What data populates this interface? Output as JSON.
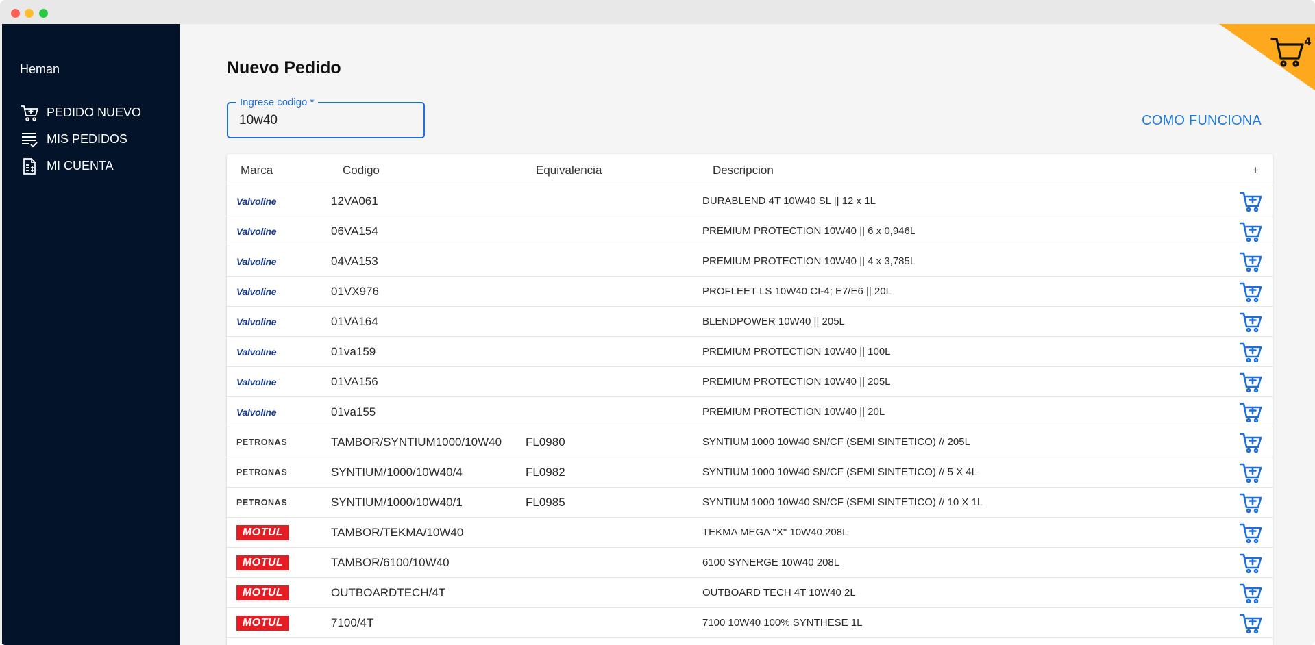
{
  "window": {
    "title": ""
  },
  "sidebar": {
    "user": "Heman",
    "items": [
      {
        "label": "PEDIDO NUEVO",
        "icon": "cart-plus-icon"
      },
      {
        "label": "MIS PEDIDOS",
        "icon": "list-check-icon"
      },
      {
        "label": "MI CUENTA",
        "icon": "document-account-icon"
      }
    ]
  },
  "header": {
    "title": "Nuevo Pedido",
    "search": {
      "label": "Ingrese codigo",
      "required_mark": "*",
      "value": "10w40"
    },
    "help_link": "COMO FUNCIONA",
    "cart_count": "4"
  },
  "colors": {
    "sidebar": "#03142a",
    "accent": "#1e6fd9",
    "cart_corner": "#fda81d",
    "motul": "#e31e24",
    "valvoline": "#1a3d8f"
  },
  "table": {
    "columns": {
      "brand": "Marca",
      "code": "Codigo",
      "equiv": "Equivalencia",
      "desc": "Descripcion",
      "add": "+"
    },
    "rows": [
      {
        "brand": "Valvoline",
        "code": "12VA061",
        "equiv": "",
        "desc": "DURABLEND 4T 10W40 SL || 12 x 1L"
      },
      {
        "brand": "Valvoline",
        "code": "06VA154",
        "equiv": "",
        "desc": "PREMIUM PROTECTION 10W40 || 6 x 0,946L"
      },
      {
        "brand": "Valvoline",
        "code": "04VA153",
        "equiv": "",
        "desc": "PREMIUM PROTECTION 10W40 || 4 x 3,785L"
      },
      {
        "brand": "Valvoline",
        "code": "01VX976",
        "equiv": "",
        "desc": "PROFLEET LS 10W40 CI-4; E7/E6 || 20L"
      },
      {
        "brand": "Valvoline",
        "code": "01VA164",
        "equiv": "",
        "desc": "BLENDPOWER 10W40 || 205L"
      },
      {
        "brand": "Valvoline",
        "code": "01va159",
        "equiv": "",
        "desc": "PREMIUM PROTECTION 10W40 || 100L"
      },
      {
        "brand": "Valvoline",
        "code": "01VA156",
        "equiv": "",
        "desc": "PREMIUM PROTECTION 10W40 || 205L"
      },
      {
        "brand": "Valvoline",
        "code": "01va155",
        "equiv": "",
        "desc": "PREMIUM PROTECTION 10W40 || 20L"
      },
      {
        "brand": "PETRONAS",
        "code": "TAMBOR/SYNTIUM1000/10W40",
        "equiv": "FL0980",
        "desc": "SYNTIUM 1000 10W40 SN/CF (SEMI SINTETICO) // 205L"
      },
      {
        "brand": "PETRONAS",
        "code": "SYNTIUM/1000/10W40/4",
        "equiv": "FL0982",
        "desc": "SYNTIUM 1000 10W40 SN/CF (SEMI SINTETICO) // 5 X 4L"
      },
      {
        "brand": "PETRONAS",
        "code": "SYNTIUM/1000/10W40/1",
        "equiv": "FL0985",
        "desc": "SYNTIUM 1000 10W40 SN/CF (SEMI SINTETICO) // 10 X 1L"
      },
      {
        "brand": "MOTUL",
        "code": "TAMBOR/TEKMA/10W40",
        "equiv": "",
        "desc": "TEKMA MEGA \"X\" 10W40 208L"
      },
      {
        "brand": "MOTUL",
        "code": "TAMBOR/6100/10W40",
        "equiv": "",
        "desc": "6100 SYNERGE 10W40 208L"
      },
      {
        "brand": "MOTUL",
        "code": "OUTBOARDTECH/4T",
        "equiv": "",
        "desc": "OUTBOARD TECH 4T 10W40 2L"
      },
      {
        "brand": "MOTUL",
        "code": "7100/4T",
        "equiv": "",
        "desc": "7100 10W40 100% SYNTHESE 1L"
      }
    ]
  }
}
